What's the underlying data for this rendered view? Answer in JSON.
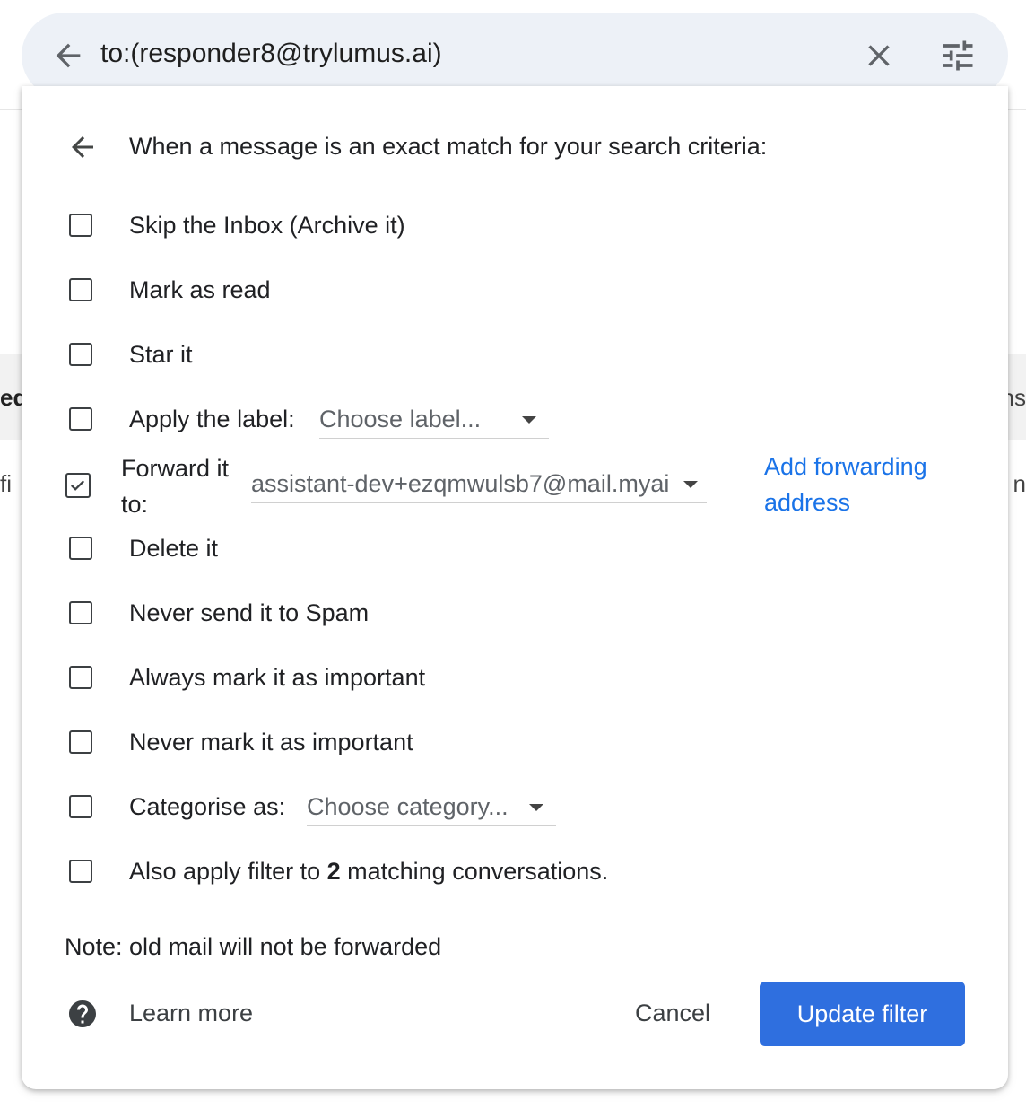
{
  "search": {
    "query": "to:(responder8@trylumus.ai)"
  },
  "background_fragments": {
    "left_1": "ed",
    "left_2": "fi",
    "right_1": "ns",
    "right_2": "n"
  },
  "filter": {
    "heading": "When a message is an exact match for your search criteria:",
    "options": {
      "skip_inbox": "Skip the Inbox (Archive it)",
      "mark_read": "Mark as read",
      "star": "Star it",
      "apply_label": "Apply the label:",
      "apply_label_select": "Choose label...",
      "forward_label": "Forward it to:",
      "forward_select": "assistant-dev+ezqmwulsb7@mail.myai",
      "add_forwarding": "Add forwarding address",
      "delete": "Delete it",
      "never_spam": "Never send it to Spam",
      "always_important": "Always mark it as important",
      "never_important": "Never mark it as important",
      "categorise": "Categorise as:",
      "categorise_select": "Choose category...",
      "also_apply_pre": "Also apply filter to ",
      "also_apply_count": "2",
      "also_apply_post": " matching conversations."
    },
    "checked": {
      "forward": true
    },
    "note": "Note: old mail will not be forwarded",
    "learn_more": "Learn more",
    "cancel": "Cancel",
    "update": "Update filter"
  },
  "colors": {
    "link": "#1a73e8",
    "primary_button": "#2f6fdf"
  }
}
